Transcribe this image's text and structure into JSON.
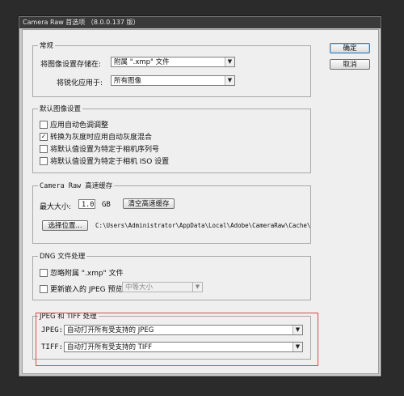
{
  "window": {
    "title": "Camera Raw 首选项 （8.0.0.137 版）"
  },
  "buttons": {
    "ok": "确定",
    "cancel": "取消"
  },
  "general": {
    "title": "常规",
    "save_label": "将图像设置存储在:",
    "save_value": "附属 \".xmp\" 文件",
    "sharpen_label": "将锐化应用于:",
    "sharpen_value": "所有图像"
  },
  "defaults": {
    "title": "默认图像设置",
    "items": [
      {
        "label": "应用自动色调调整",
        "checked": false
      },
      {
        "label": "转换为灰度时应用自动灰度混合",
        "checked": true
      },
      {
        "label": "将默认值设置为特定于相机序列号",
        "checked": false
      },
      {
        "label": "将默认值设置为特定于相机 ISO 设置",
        "checked": false
      }
    ]
  },
  "cache": {
    "title": "Camera Raw 高速缓存",
    "max_label": "最大大小:",
    "max_value": "1.0",
    "unit": "GB",
    "purge_label": "清空高速缓存",
    "select_label": "选择位置...",
    "path": "C:\\Users\\Administrator\\AppData\\Local\\Adobe\\CameraRaw\\Cache\\"
  },
  "dng": {
    "title": "DNG 文件处理",
    "ignore_label": "忽略附属 \".xmp\" 文件",
    "ignore_checked": false,
    "update_label": "更新嵌入的 JPEG 预览:",
    "update_checked": false,
    "update_value": "中等大小"
  },
  "jpeg_tiff": {
    "title": "JPEG 和 TIFF 处理",
    "jpeg_label": "JPEG:",
    "jpeg_value": "自动打开所有受支持的 JPEG",
    "tiff_label": "TIFF:",
    "tiff_value": "自动打开所有受支持的 TIFF"
  },
  "colors": {
    "highlight": "#d74c4c",
    "dialog_bg": "#efefef",
    "window_bg": "#2b2b2b"
  }
}
